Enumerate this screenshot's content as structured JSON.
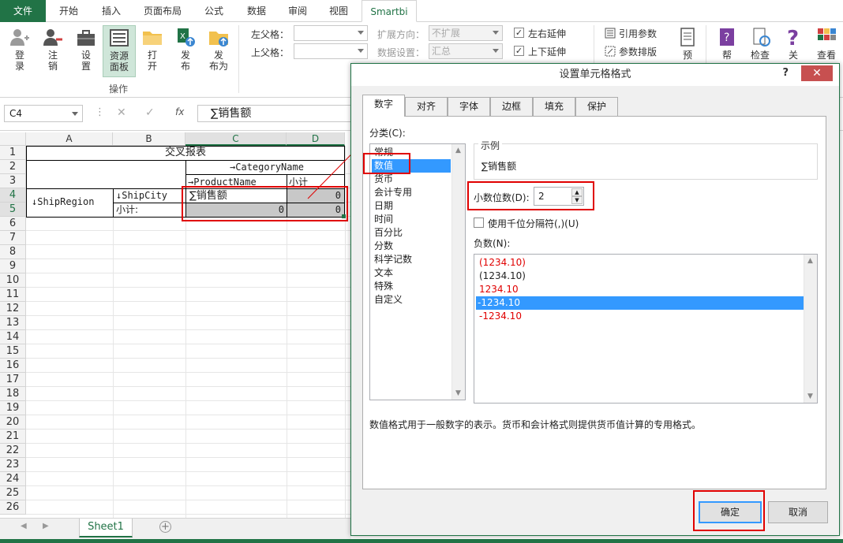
{
  "ribbon_tabs": [
    "文件",
    "开始",
    "插入",
    "页面布局",
    "公式",
    "数据",
    "审阅",
    "视图",
    "Smartbi"
  ],
  "ribbon": {
    "buttons": [
      "登录",
      "注销",
      "设置",
      "资源面板",
      "打开",
      "发布",
      "发布为"
    ],
    "buttons_split": [
      [
        "登",
        "录"
      ],
      [
        "注",
        "销"
      ],
      [
        "设",
        "置"
      ],
      [
        "资源",
        "面板"
      ],
      [
        "打",
        "开"
      ],
      [
        "发",
        "布"
      ],
      [
        "发",
        "布为"
      ]
    ],
    "group_label": "操作",
    "left_parent_label": "左父格：",
    "top_parent_label": "上父格：",
    "expand_dir_label": "扩展方向：",
    "expand_dir_value": "不扩展",
    "data_setting_label": "数据设置：",
    "data_setting_value": "汇总",
    "lr_extend": "左右延伸",
    "ud_extend": "上下延伸",
    "ref_param": "引用参数",
    "param_layout": "参数排版",
    "right_buttons": [
      "预",
      "帮",
      "检查",
      "关",
      "查看"
    ]
  },
  "formula_bar": {
    "name_box": "C4",
    "fx": "fx",
    "value": "∑销售额"
  },
  "grid": {
    "columns": [
      "A",
      "B",
      "C",
      "D"
    ],
    "rows": [
      "1",
      "2",
      "3",
      "4",
      "5",
      "6",
      "7",
      "8",
      "9",
      "10",
      "11",
      "12",
      "13",
      "14",
      "15",
      "16",
      "17",
      "18",
      "19",
      "20",
      "21",
      "22",
      "23",
      "24",
      "25",
      "26"
    ],
    "cells": {
      "title": "交叉报表",
      "category": "→CategoryName",
      "product": "→ProductName",
      "subtotal_col": "小计",
      "ship_region": "↓ShipRegion",
      "ship_city": "↓ShipCity",
      "subtotal_row": "小计:",
      "measure": "∑销售额",
      "d4": "0",
      "c5": "0",
      "d5": "0"
    }
  },
  "sheet_tab": "Sheet1",
  "dialog": {
    "title": "设置单元格格式",
    "help": "?",
    "close": "✕",
    "tabs": [
      "数字",
      "对齐",
      "字体",
      "边框",
      "填充",
      "保护"
    ],
    "category_label": "分类(C):",
    "categories": [
      "常规",
      "数值",
      "货币",
      "会计专用",
      "日期",
      "时间",
      "百分比",
      "分数",
      "科学记数",
      "文本",
      "特殊",
      "自定义"
    ],
    "sample_label": "示例",
    "sample_value": "∑销售额",
    "decimal_label": "小数位数(D):",
    "decimal_value": "2",
    "thousand_sep": "使用千位分隔符(,)(U)",
    "negative_label": "负数(N):",
    "negatives": [
      {
        "text": "(1234.10)",
        "color": "#e00000"
      },
      {
        "text": "(1234.10)",
        "color": "#222222"
      },
      {
        "text": "1234.10",
        "color": "#e00000"
      },
      {
        "text": "-1234.10",
        "color": "#ffffff"
      },
      {
        "text": "-1234.10",
        "color": "#e00000"
      }
    ],
    "description": "数值格式用于一般数字的表示。货币和会计格式则提供货币值计算的专用格式。",
    "ok": "确定",
    "cancel": "取消"
  }
}
